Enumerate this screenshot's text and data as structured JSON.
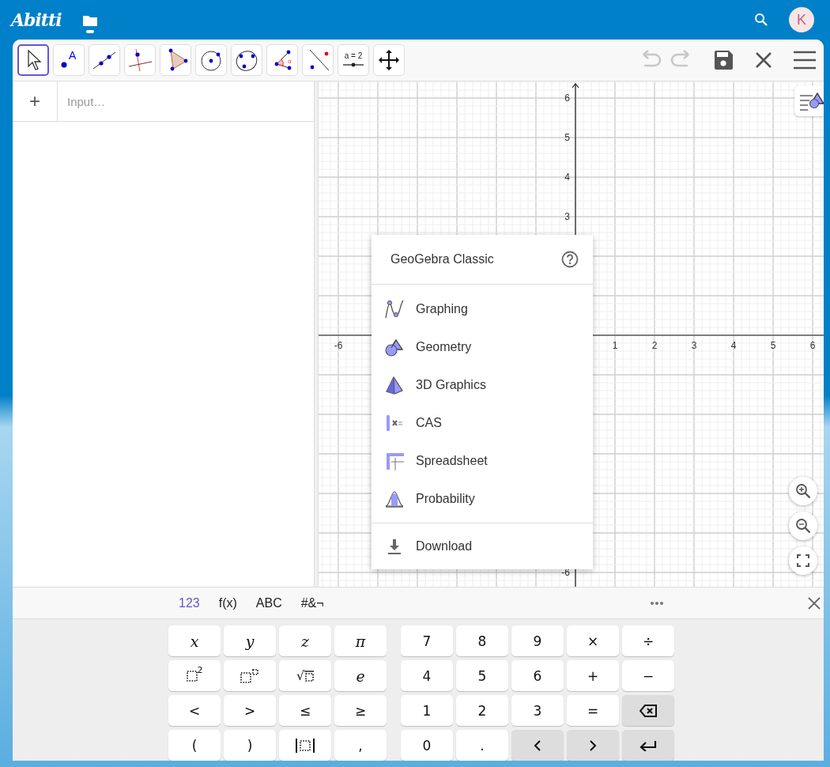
{
  "header": {
    "logo": "Abitti",
    "avatar": "K"
  },
  "toolbar": {
    "tools": [
      {
        "kind": "move",
        "selected": true
      },
      {
        "kind": "point",
        "label": "A",
        "selected": false
      },
      {
        "kind": "line",
        "selected": false
      },
      {
        "kind": "perpendicular",
        "selected": false
      },
      {
        "kind": "polygon",
        "selected": false
      },
      {
        "kind": "circle",
        "selected": false
      },
      {
        "kind": "conic",
        "selected": false
      },
      {
        "kind": "angle",
        "label": "α",
        "selected": false
      },
      {
        "kind": "reflect",
        "selected": false
      },
      {
        "kind": "slider",
        "label": "a = 2",
        "selected": false
      },
      {
        "kind": "move-view",
        "selected": false
      }
    ],
    "undo": {
      "disabled": true
    },
    "redo": {
      "disabled": true
    }
  },
  "algebra": {
    "add": "+",
    "placeholder": "Input…"
  },
  "graphics": {
    "chart_data": {
      "type": "line",
      "grid": true,
      "xlim": [
        -6.5,
        6.28
      ],
      "ylim": [
        -6.36,
        6.42
      ],
      "xticks": [
        {
          "value": -6,
          "label": "-6"
        },
        1,
        2,
        3,
        4,
        5,
        6
      ],
      "yticks": [
        {
          "value": -6,
          "label": "-6"
        },
        3,
        4,
        5,
        6
      ]
    }
  },
  "menu": {
    "title": "GeoGebra Classic",
    "items": [
      {
        "kind": "graphing",
        "label": "Graphing"
      },
      {
        "kind": "geometry",
        "label": "Geometry"
      },
      {
        "kind": "solid",
        "label": "3D Graphics"
      },
      {
        "kind": "cas",
        "label": "CAS"
      },
      {
        "kind": "spreadsheet",
        "label": "Spreadsheet"
      },
      {
        "kind": "probability",
        "label": "Probability"
      }
    ],
    "footer": {
      "kind": "download",
      "label": "Download"
    }
  },
  "keyboard": {
    "tabs": [
      {
        "label": "123",
        "selected": true
      },
      {
        "label": "f(x)",
        "selected": false
      },
      {
        "label": "ABC",
        "selected": false
      },
      {
        "label": "#&¬",
        "selected": false
      }
    ],
    "left": [
      [
        {
          "kind": "variable",
          "label": "x"
        },
        {
          "kind": "variable",
          "label": "y"
        },
        {
          "kind": "variable",
          "label": "z"
        },
        {
          "kind": "variable",
          "label": "π"
        }
      ],
      [
        {
          "kind": "square",
          "label": "2"
        },
        {
          "kind": "power"
        },
        {
          "kind": "sqrt",
          "label": "√"
        },
        {
          "kind": "variable",
          "label": "e"
        }
      ],
      [
        {
          "kind": "text",
          "label": "<"
        },
        {
          "kind": "text",
          "label": ">"
        },
        {
          "kind": "text",
          "label": "≤"
        },
        {
          "kind": "text",
          "label": "≥"
        }
      ],
      [
        {
          "kind": "text",
          "label": "("
        },
        {
          "kind": "text",
          "label": ")"
        },
        {
          "kind": "abs"
        },
        {
          "kind": "text",
          "label": ","
        }
      ]
    ],
    "right": [
      [
        {
          "kind": "text",
          "label": "7"
        },
        {
          "kind": "text",
          "label": "8"
        },
        {
          "kind": "text",
          "label": "9"
        },
        {
          "kind": "text",
          "label": "×"
        },
        {
          "kind": "text",
          "label": "÷"
        }
      ],
      [
        {
          "kind": "text",
          "label": "4"
        },
        {
          "kind": "text",
          "label": "5"
        },
        {
          "kind": "text",
          "label": "6"
        },
        {
          "kind": "text",
          "label": "+"
        },
        {
          "kind": "text",
          "label": "−"
        }
      ],
      [
        {
          "kind": "text",
          "label": "1"
        },
        {
          "kind": "text",
          "label": "2"
        },
        {
          "kind": "text",
          "label": "3"
        },
        {
          "kind": "text",
          "label": "="
        },
        {
          "kind": "backspace"
        }
      ],
      [
        {
          "kind": "text",
          "label": "0"
        },
        {
          "kind": "text",
          "label": "."
        },
        {
          "kind": "left"
        },
        {
          "kind": "right"
        },
        {
          "kind": "enter"
        }
      ]
    ]
  }
}
